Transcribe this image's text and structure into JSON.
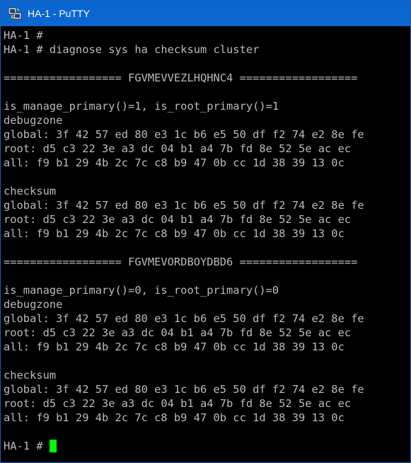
{
  "window": {
    "title": "HA-1 - PuTTY",
    "icon": "putty-icon"
  },
  "terminal": {
    "lines": [
      "HA-1 #",
      "HA-1 # diagnose sys ha checksum cluster",
      "",
      "================== FGVMEVVEZLHQHNC4 ==================",
      "",
      "is_manage_primary()=1, is_root_primary()=1",
      "debugzone",
      "global: 3f 42 57 ed 80 e3 1c b6 e5 50 df f2 74 e2 8e fe",
      "root: d5 c3 22 3e a3 dc 04 b1 a4 7b fd 8e 52 5e ac ec",
      "all: f9 b1 29 4b 2c 7c c8 b9 47 0b cc 1d 38 39 13 0c",
      "",
      "checksum",
      "global: 3f 42 57 ed 80 e3 1c b6 e5 50 df f2 74 e2 8e fe",
      "root: d5 c3 22 3e a3 dc 04 b1 a4 7b fd 8e 52 5e ac ec",
      "all: f9 b1 29 4b 2c 7c c8 b9 47 0b cc 1d 38 39 13 0c",
      "",
      "================== FGVMEVORDBOYDBD6 ==================",
      "",
      "is_manage_primary()=0, is_root_primary()=0",
      "debugzone",
      "global: 3f 42 57 ed 80 e3 1c b6 e5 50 df f2 74 e2 8e fe",
      "root: d5 c3 22 3e a3 dc 04 b1 a4 7b fd 8e 52 5e ac ec",
      "all: f9 b1 29 4b 2c 7c c8 b9 47 0b cc 1d 38 39 13 0c",
      "",
      "checksum",
      "global: 3f 42 57 ed 80 e3 1c b6 e5 50 df f2 74 e2 8e fe",
      "root: d5 c3 22 3e a3 dc 04 b1 a4 7b fd 8e 52 5e ac ec",
      "all: f9 b1 29 4b 2c 7c c8 b9 47 0b cc 1d 38 39 13 0c",
      "",
      "HA-1 # "
    ],
    "prompt": "HA-1 # ",
    "cursor_color": "#00ff00",
    "text_color": "#bbbbbb",
    "background_color": "#000000"
  },
  "colors": {
    "titlebar": "#0b67d0",
    "title_text": "#ffffff"
  }
}
